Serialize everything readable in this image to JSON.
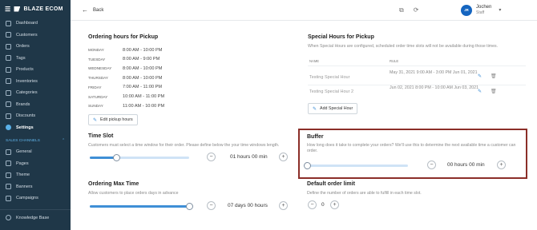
{
  "brand": {
    "name": "BLAZE ECOM"
  },
  "sidebar": {
    "items": [
      {
        "label": "Dashboard",
        "icon": "dashboard-icon"
      },
      {
        "label": "Customers",
        "icon": "customers-icon"
      },
      {
        "label": "Orders",
        "icon": "orders-icon"
      },
      {
        "label": "Tags",
        "icon": "tag-icon"
      },
      {
        "label": "Products",
        "icon": "products-icon"
      },
      {
        "label": "Inventories",
        "icon": "inventory-icon"
      },
      {
        "label": "Categories",
        "icon": "categories-icon"
      },
      {
        "label": "Brands",
        "icon": "brands-icon"
      },
      {
        "label": "Discounts",
        "icon": "discount-icon"
      },
      {
        "label": "Settings",
        "icon": "gear-icon",
        "active": true
      }
    ],
    "channels_header": "SALES CHANNELS",
    "channel_items": [
      {
        "label": "General",
        "icon": "general-icon"
      },
      {
        "label": "Pages",
        "icon": "pages-icon"
      },
      {
        "label": "Theme",
        "icon": "theme-icon"
      },
      {
        "label": "Banners",
        "icon": "banners-icon"
      },
      {
        "label": "Campaigns",
        "icon": "campaigns-icon"
      }
    ],
    "footer_item": {
      "label": "Knowledge Base",
      "icon": "help-icon"
    }
  },
  "topbar": {
    "back_label": "Back",
    "user": {
      "initials": "JR",
      "name": "Jochen",
      "role": "Staff"
    }
  },
  "ordering_hours": {
    "title": "Ordering hours for Pickup",
    "rows": [
      {
        "day": "MONDAY",
        "time": "8:00 AM - 10:00 PM"
      },
      {
        "day": "TUESDAY",
        "time": "8:00 AM - 9:00 PM"
      },
      {
        "day": "WEDNESDAY",
        "time": "8:00 AM - 10:00 PM"
      },
      {
        "day": "THURSDAY",
        "time": "8:00 AM - 10:00 PM"
      },
      {
        "day": "FRIDAY",
        "time": "7:00 AM - 11:00 PM"
      },
      {
        "day": "SATURDAY",
        "time": "10:00 AM - 11:00 PM"
      },
      {
        "day": "SUNDAY",
        "time": "11:00 AM - 10:00 PM"
      }
    ],
    "edit_button": "Edit pickup hours"
  },
  "special_hours": {
    "title": "Special Hours for Pickup",
    "desc": "When Special Hours are configured, scheduled order time slots will not be available during those times.",
    "col_name": "NAME",
    "col_rule": "RULE",
    "rows": [
      {
        "name": "Testing Special Hour",
        "rule": "May 31, 2021 9:00 AM - 3:00 PM Jun 01, 2021"
      },
      {
        "name": "Testing Special Hour 2",
        "rule": "Jun 02, 2021 8:00 PM - 10:00 AM Jun 03, 2021"
      }
    ],
    "add_button": "Add Special Hour"
  },
  "time_slot": {
    "title": "Time Slot",
    "desc": "Customers must select a time window for their order. Please define below the your time windows length.",
    "value": "01 hours 00 min",
    "slider_fraction": 0.27
  },
  "buffer": {
    "title": "Buffer",
    "desc": "How long does it take to complete your orders? We'll use this to determine the next available time a customer can order.",
    "value": "00 hours 00 min",
    "slider_fraction": 0.0
  },
  "ordering_max_time": {
    "title": "Ordering Max Time",
    "desc": "Allow customers to place orders days in advance",
    "value": "07 days 00 hours",
    "slider_fraction": 1.0
  },
  "default_order_limit": {
    "title": "Default order limit",
    "desc": "Define the number of orders are able to fulfill in each time slot.",
    "value": "0"
  },
  "colors": {
    "sidebar_bg": "#1f3748",
    "accent": "#3f8fd6",
    "highlight": "#8b2e28"
  }
}
